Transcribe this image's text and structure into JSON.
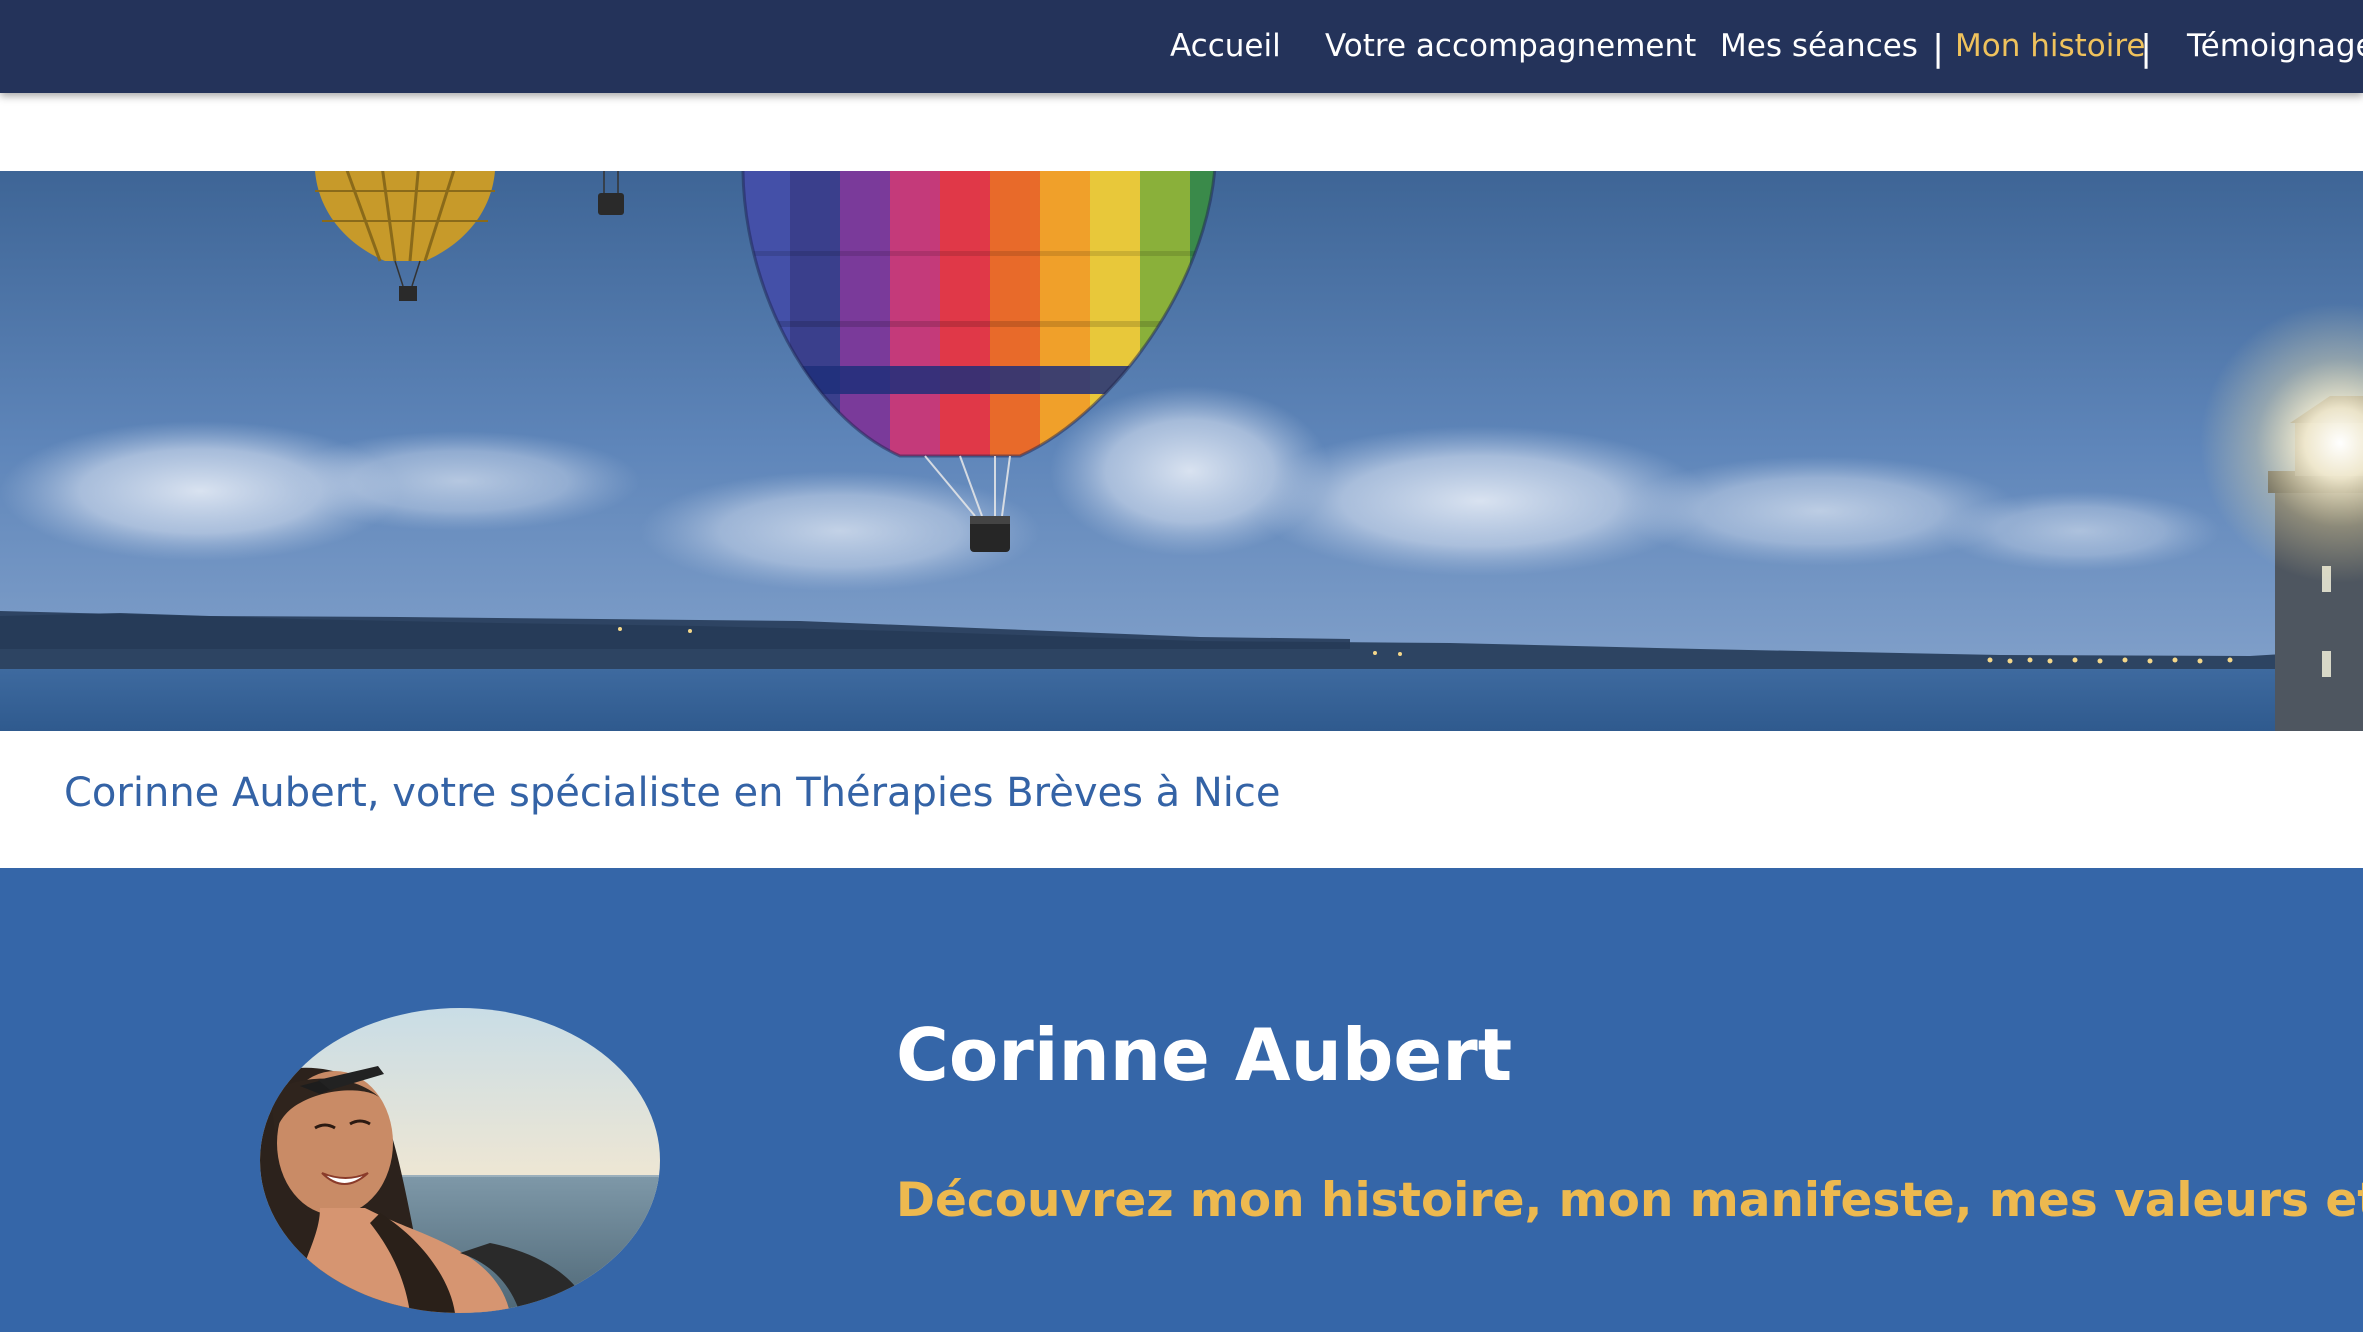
{
  "nav": {
    "items": [
      {
        "label": "Accueil",
        "active": false
      },
      {
        "label": "Votre accompagnement",
        "active": false
      },
      {
        "label": "Mes séances",
        "active": false
      },
      {
        "label": "Mon histoire",
        "active": true
      },
      {
        "label": "Témoignage",
        "active": false
      }
    ],
    "separator": "|"
  },
  "hero": {
    "image": "hot-air-balloons-over-sea-with-lighthouse"
  },
  "tagline": "Corinne Aubert, votre spécialiste en Thérapies Brèves à Nice",
  "profile": {
    "name": "Corinne Aubert",
    "subtitle": "Découvrez mon histoire, mon manifeste, mes valeurs et mon",
    "avatar": "portrait-photo"
  },
  "colors": {
    "nav_bg": "#24335a",
    "nav_active": "#efc25c",
    "tagline": "#3463a6",
    "section_bg": "#3566a8",
    "subtitle": "#edb94f"
  }
}
